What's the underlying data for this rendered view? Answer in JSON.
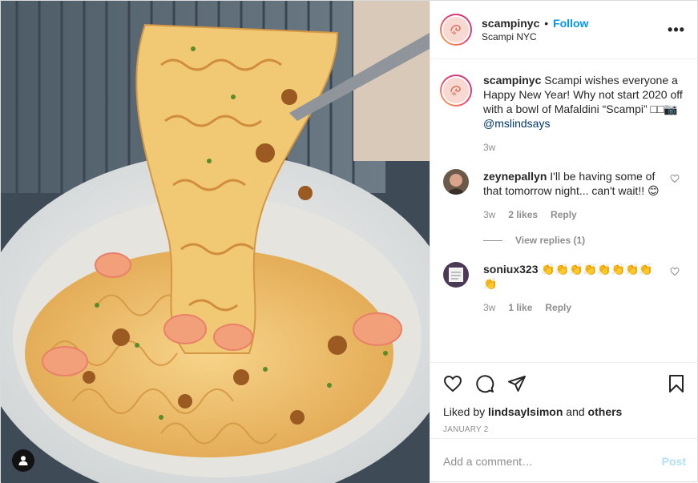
{
  "post": {
    "username": "scampinyc",
    "follow_label": "Follow",
    "location": "Scampi NYC",
    "more_glyph": "•••",
    "image_alt": "Plate of Mafaldini pasta with shrimp and breadcrumbs lifted on a fork",
    "caption": {
      "username": "scampinyc",
      "text": "Scampi wishes everyone a Happy New Year! Why not start 2020 off with a bowl of Mafaldini “Scampi” □□📷",
      "mention": "@mslindsays",
      "time": "3w"
    },
    "comments": [
      {
        "username": "zeynepallyn",
        "text": "I'll be having some of that tomorrow night... can't wait!! 😊",
        "time": "3w",
        "likes": "2 likes",
        "reply_label": "Reply",
        "view_replies": "View replies (1)"
      },
      {
        "username": "soniux323",
        "text": "👏👏👏👏👏👏👏👏👏",
        "time": "3w",
        "likes": "1 like",
        "reply_label": "Reply"
      }
    ],
    "liked_by_prefix": "Liked by",
    "liked_by_user": "lindsaylsimon",
    "liked_by_and": "and",
    "liked_by_others": "others",
    "date": "JANUARY 2",
    "add_comment_placeholder": "Add a comment…",
    "post_label": "Post"
  },
  "icons": [
    "user-tag-icon",
    "heart-icon",
    "comment-icon",
    "share-icon",
    "bookmark-icon",
    "more-icon",
    "small-heart-icon"
  ],
  "colors": {
    "accent": "#0095f6",
    "muted": "#8e8e8e",
    "post_disabled": "#b2dffc",
    "mention": "#00376b"
  }
}
